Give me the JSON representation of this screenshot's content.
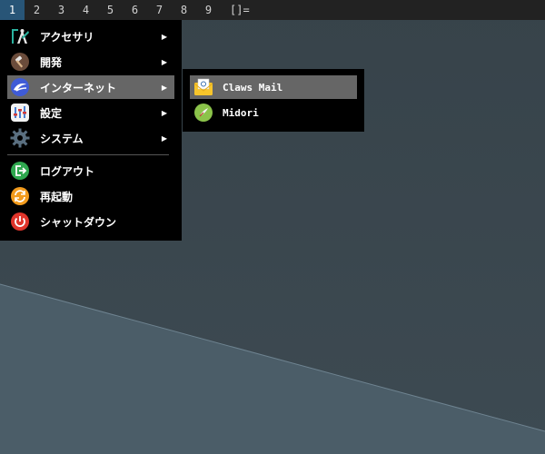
{
  "topbar": {
    "workspaces": [
      "1",
      "2",
      "3",
      "4",
      "5",
      "6",
      "7",
      "8",
      "9"
    ],
    "active_workspace": "1",
    "layout": "[]="
  },
  "main_menu": {
    "items": [
      {
        "label": "アクセサリ",
        "icon": "accessories-icon",
        "submenu": true
      },
      {
        "label": "開発",
        "icon": "development-icon",
        "submenu": true
      },
      {
        "label": "インターネット",
        "icon": "internet-icon",
        "submenu": true,
        "highlighted": true
      },
      {
        "label": "設定",
        "icon": "settings-icon",
        "submenu": true
      },
      {
        "label": "システム",
        "icon": "system-gear-icon",
        "submenu": true
      }
    ],
    "actions": [
      {
        "label": "ログアウト",
        "icon": "logout-icon"
      },
      {
        "label": "再起動",
        "icon": "reboot-icon"
      },
      {
        "label": "シャットダウン",
        "icon": "power-icon"
      }
    ],
    "submenu_arrow": "▶"
  },
  "internet_submenu": {
    "items": [
      {
        "label": "Claws Mail",
        "icon": "mail-icon",
        "highlighted": true
      },
      {
        "label": "Midori",
        "icon": "browser-icon"
      }
    ]
  },
  "colors": {
    "topbar_bg": "#222222",
    "active_workspace_bg": "#285577",
    "menu_bg": "#000000",
    "highlight_bg": "#666666",
    "desktop_dark": "#3a464e",
    "desktop_light": "#4d5f6a"
  }
}
